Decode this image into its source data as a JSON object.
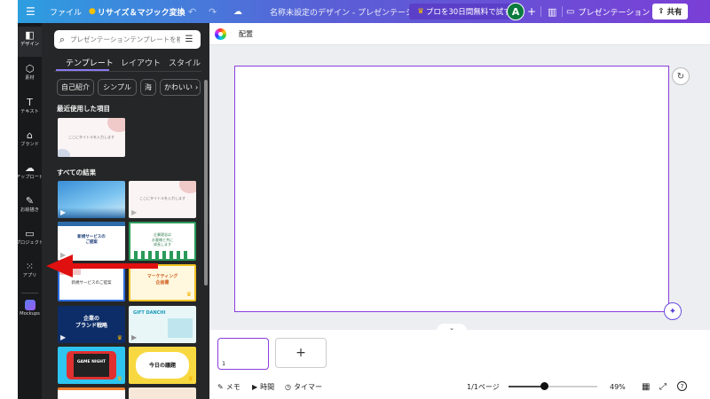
{
  "topbar": {
    "file": "ファイル",
    "resize": "リサイズ＆マジック変換",
    "doc_title": "名称未設定のデザイン - プレゼンテーション",
    "trial_button": "プロを30日間無料で試す",
    "avatar_initial": "A",
    "present_button": "プレゼンテーション",
    "share_button": "共有"
  },
  "rail": {
    "items": [
      {
        "label": "デザイン",
        "icon": "design-icon"
      },
      {
        "label": "素材",
        "icon": "elements-icon"
      },
      {
        "label": "テキスト",
        "icon": "text-icon"
      },
      {
        "label": "ブランド",
        "icon": "brand-icon"
      },
      {
        "label": "アップロード",
        "icon": "upload-icon"
      },
      {
        "label": "お絵描き",
        "icon": "draw-icon"
      },
      {
        "label": "プロジェクト",
        "icon": "folder-icon"
      },
      {
        "label": "アプリ",
        "icon": "apps-icon"
      },
      {
        "label": "Mockups",
        "icon": "mockups-icon"
      }
    ]
  },
  "panel": {
    "search_placeholder": "プレゼンテーションテンプレートを検",
    "tabs": [
      "テンプレート",
      "レイアウト",
      "スタイル"
    ],
    "chips": [
      "自己紹介",
      "シンプル",
      "海",
      "かわいい"
    ],
    "recent_title": "最近使用した項目",
    "results_title": "すべての結果",
    "recent_thumb_text": "ここにタイトルを入力します",
    "thumbs": [
      {
        "text": ""
      },
      {
        "text": "ここにタイトルを入力します"
      },
      {
        "text": "新規サービスの\nご提案"
      },
      {
        "text": "企業理念は\nお客様と共に\n成長します"
      },
      {
        "text": "新規サービスのご提案"
      },
      {
        "text": "マーケティング\n企画書"
      },
      {
        "text": "企業の\nブランド戦略"
      },
      {
        "text": "GIFT DANCHI"
      },
      {
        "text": "GAME NIGHT"
      },
      {
        "text": "今日の議題"
      }
    ]
  },
  "context": {
    "arrange": "配置"
  },
  "footer": {
    "notes": "メモ",
    "timer_label": "時間",
    "timer": "タイマー",
    "page_count": "1/1ページ",
    "zoom": "49%",
    "page_number": "1"
  },
  "colors": {
    "accent": "#8b3ddb",
    "arrow": "#e01010",
    "panel_bg": "#252627",
    "rail_bg": "#18191b"
  }
}
